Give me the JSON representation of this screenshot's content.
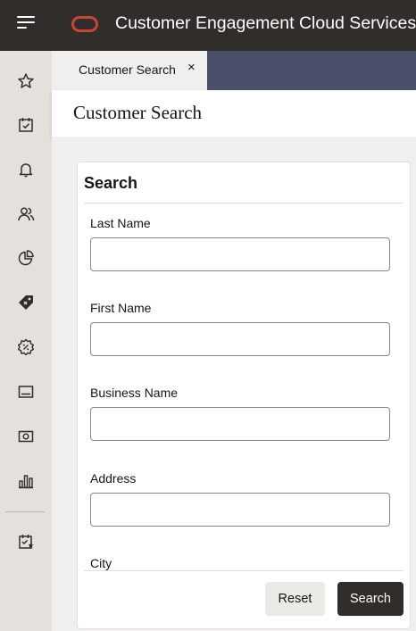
{
  "header": {
    "app_title": "Customer Engagement Cloud Services",
    "menu_icon": "hamburger-menu-icon",
    "logo_icon": "oracle-logo-icon",
    "logo_color": "#c74634"
  },
  "rail": {
    "items": [
      {
        "icon": "star-icon"
      },
      {
        "icon": "calendar-check-icon"
      },
      {
        "icon": "bell-icon"
      },
      {
        "icon": "people-icon"
      },
      {
        "icon": "pie-chart-icon"
      },
      {
        "icon": "price-tag-icon"
      },
      {
        "icon": "percent-badge-icon"
      },
      {
        "icon": "screen-icon"
      },
      {
        "icon": "camera-icon"
      },
      {
        "icon": "bar-chart-icon"
      },
      {
        "icon": "task-star-icon"
      }
    ]
  },
  "tabs": [
    {
      "label": "Customer Search",
      "close": "×"
    }
  ],
  "page": {
    "title": "Customer Search"
  },
  "search_panel": {
    "title": "Search",
    "fields": [
      {
        "label": "Last Name",
        "value": ""
      },
      {
        "label": "First Name",
        "value": ""
      },
      {
        "label": "Business Name",
        "value": ""
      },
      {
        "label": "Address",
        "value": ""
      },
      {
        "label": "City",
        "value": ""
      }
    ],
    "reset_label": "Reset",
    "search_label": "Search"
  },
  "colors": {
    "header_bg": "#312d2a",
    "tabstrip_bg": "#4a5069",
    "rail_bg": "#e4e1dd",
    "primary_button": "#312d2a"
  }
}
